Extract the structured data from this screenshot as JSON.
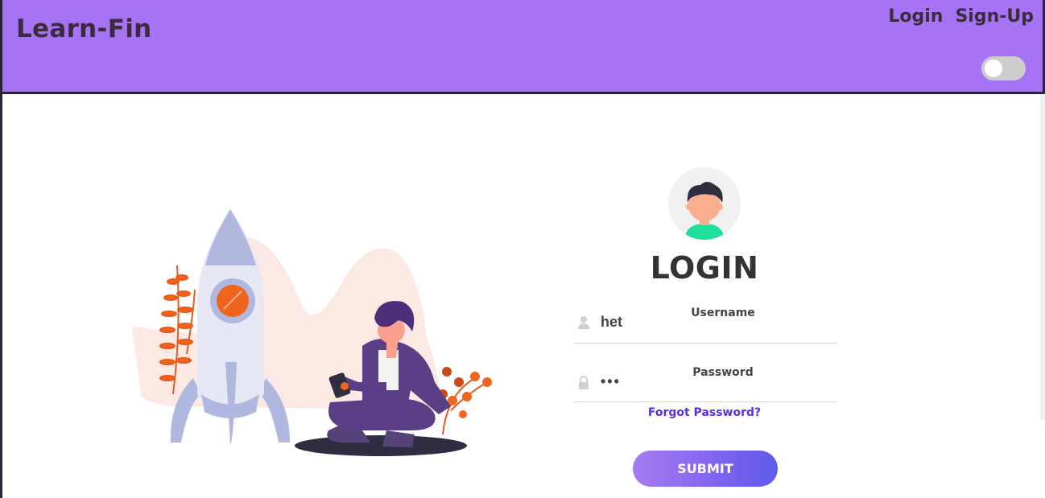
{
  "app": {
    "brand": "Learn-Fin"
  },
  "nav": {
    "login_label": "Login",
    "signup_label": "Sign-Up"
  },
  "theme_toggle": {
    "enabled": false
  },
  "login": {
    "title": "LOGIN",
    "username": {
      "label": "Username",
      "value": "het",
      "icon": "user-icon"
    },
    "password": {
      "label": "Password",
      "value": "•••",
      "icon": "lock-icon"
    },
    "forgot_label": "Forgot Password?",
    "submit_label": "SUBMIT"
  },
  "colors": {
    "navbar": "#a673f4",
    "accent_link": "#5a2de0",
    "submit_start": "#a77cf2",
    "submit_end": "#5d5ce9"
  }
}
